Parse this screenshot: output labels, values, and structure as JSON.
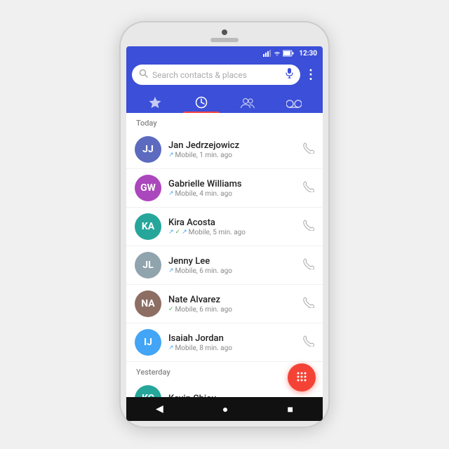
{
  "phone": {
    "time": "12:30"
  },
  "search": {
    "placeholder": "Search contacts & places"
  },
  "tabs": [
    {
      "id": "favorites",
      "icon": "★",
      "active": false
    },
    {
      "id": "recent",
      "icon": "🕐",
      "active": true
    },
    {
      "id": "contacts",
      "icon": "👥",
      "active": false
    },
    {
      "id": "voicemail",
      "icon": "⌫",
      "active": false
    }
  ],
  "sections": [
    {
      "label": "Today",
      "contacts": [
        {
          "name": "Jan Jedrzejowicz",
          "detail": "Mobile, 1 min. ago",
          "call_type": "outgoing",
          "av_color": "av-blue",
          "initials": "JJ"
        },
        {
          "name": "Gabrielle Williams",
          "detail": "Mobile, 4 min. ago",
          "call_type": "outgoing",
          "av_color": "av-purple",
          "initials": "GW"
        },
        {
          "name": "Kira Acosta",
          "detail": "Mobile, 5 min. ago",
          "call_type": "mixed",
          "av_color": "av-teal",
          "initials": "KA"
        },
        {
          "name": "Jenny Lee",
          "detail": "Mobile, 6 min. ago",
          "call_type": "outgoing",
          "av_color": "av-grey",
          "initials": "JL"
        },
        {
          "name": "Nate Alvarez",
          "detail": "Mobile, 6 min. ago",
          "call_type": "answered",
          "av_color": "av-brown",
          "initials": "NA"
        },
        {
          "name": "Isaiah Jordan",
          "detail": "Mobile, 8 min. ago",
          "call_type": "outgoing",
          "av_color": "av-indigo",
          "initials": "IJ"
        }
      ]
    },
    {
      "label": "Yesterday",
      "contacts": [
        {
          "name": "Kevin Chieu",
          "detail": "",
          "call_type": "outgoing",
          "av_color": "av-teal",
          "initials": "KC"
        }
      ]
    }
  ],
  "fab": {
    "icon": "⠿"
  },
  "nav": {
    "back": "◀",
    "home": "●",
    "recent": "■"
  }
}
